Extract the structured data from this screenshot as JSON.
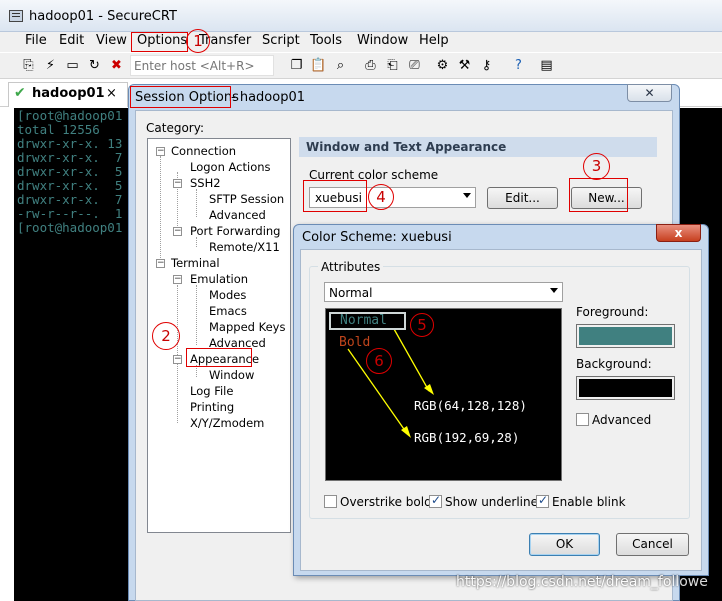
{
  "window": {
    "title": "hadoop01 - SecureCRT"
  },
  "menu": [
    "File",
    "Edit",
    "View",
    "Options",
    "Transfer",
    "Script",
    "Tools",
    "Window",
    "Help"
  ],
  "toolbar": {
    "host_placeholder": "Enter host <Alt+R>"
  },
  "tab": {
    "label": "hadoop01",
    "close": "×"
  },
  "terminal": {
    "lines": [
      "[root@hadoop01",
      "total 12556",
      "drwxr-xr-x. 13",
      "drwxr-xr-x.  7",
      "drwxr-xr-x.  5",
      "drwxr-xr-x.  5",
      "drwxr-xr-x.  7",
      "-rw-r--r--.  1",
      "[root@hadoop01"
    ],
    "color": "#408080"
  },
  "session_options": {
    "title": "Session Options",
    "subtitle": "- hadoop01",
    "category_label": "Category:",
    "tree": {
      "connection": "Connection",
      "logon_actions": "Logon Actions",
      "ssh2": "SSH2",
      "sftp_session": "SFTP Session",
      "advanced1": "Advanced",
      "port_forwarding": "Port Forwarding",
      "remote_x11": "Remote/X11",
      "terminal": "Terminal",
      "emulation": "Emulation",
      "modes": "Modes",
      "emacs": "Emacs",
      "mapped_keys": "Mapped Keys",
      "advanced2": "Advanced",
      "appearance": "Appearance",
      "window": "Window",
      "log_file": "Log File",
      "printing": "Printing",
      "xyzmodem": "X/Y/Zmodem"
    },
    "section_header": "Window and Text Appearance",
    "current_scheme_label": "Current color scheme",
    "current_scheme_value": "xuebusi",
    "edit_button": "Edit...",
    "new_button": "New..."
  },
  "color_scheme": {
    "title": "Color Scheme: xuebusi",
    "close": "x",
    "attributes_label": "Attributes",
    "attribute_select": "Normal",
    "preview_normal": "Normal",
    "preview_bold": "Bold",
    "rgb_normal": "RGB(64,128,128)",
    "rgb_bold": "RGB(192,69,28)",
    "foreground_label": "Foreground:",
    "foreground_color": "#408080",
    "background_label": "Background:",
    "background_color": "#000000",
    "advanced_label": "Advanced",
    "overstrike_bold": "Overstrike bold",
    "show_underline": "Show underline",
    "enable_blink": "Enable blink",
    "ok_button": "OK",
    "cancel_button": "Cancel"
  },
  "annotations": [
    "1",
    "2",
    "3",
    "4",
    "5",
    "6"
  ],
  "watermark": "https://blog.csdn.net/dream_followe",
  "colors": {
    "annotation": "#e00000",
    "bold_color": "#c0451c",
    "arrow": "#ffff00"
  }
}
